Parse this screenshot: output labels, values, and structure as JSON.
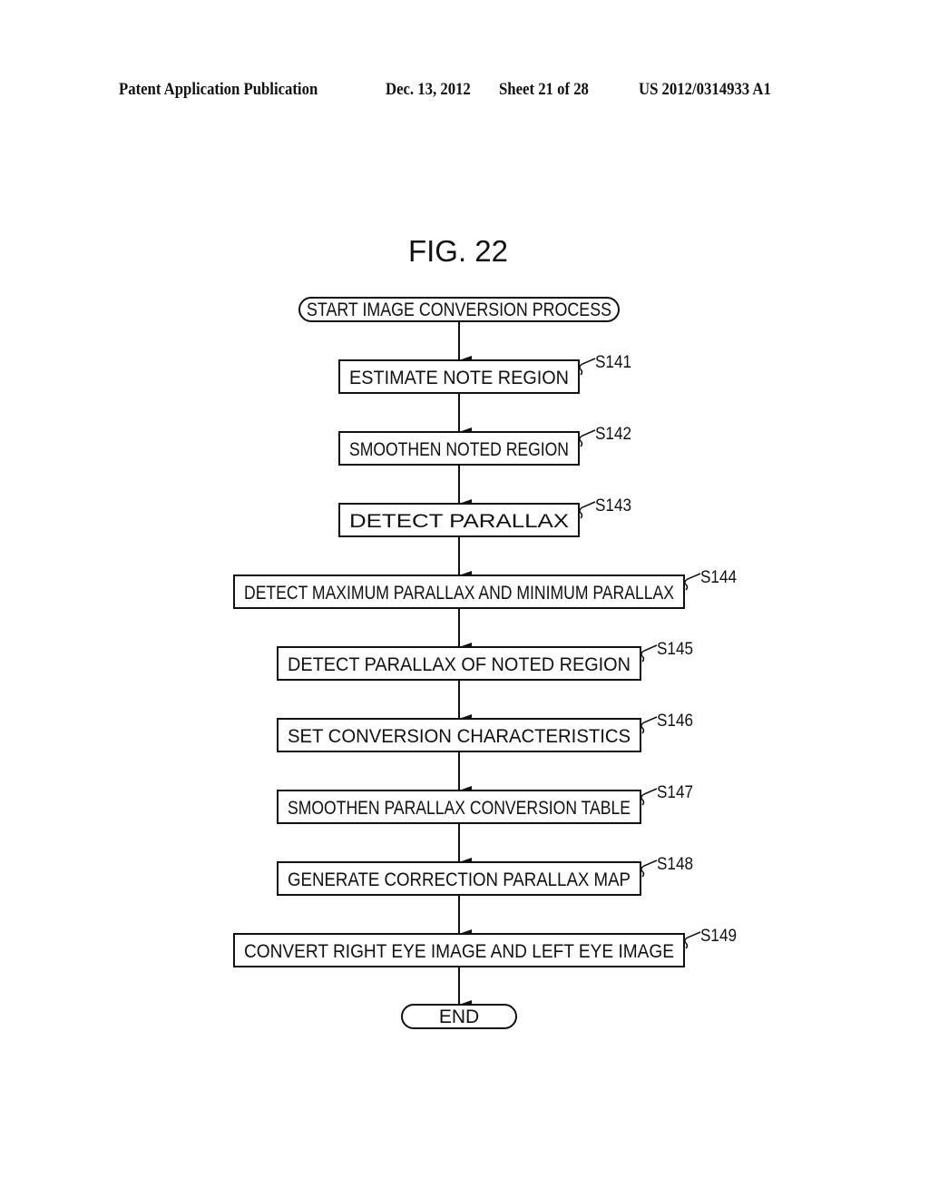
{
  "header": {
    "publication": "Patent Application Publication",
    "date": "Dec. 13, 2012",
    "sheet": "Sheet 21 of 28",
    "patent_number": "US 2012/0314933 A1"
  },
  "figure": {
    "title": "FIG. 22",
    "start": "START IMAGE CONVERSION PROCESS",
    "end": "END",
    "steps": [
      {
        "id": "S141",
        "label": "ESTIMATE NOTE REGION"
      },
      {
        "id": "S142",
        "label": "SMOOTHEN NOTED REGION"
      },
      {
        "id": "S143",
        "label": "DETECT PARALLAX"
      },
      {
        "id": "S144",
        "label": "DETECT MAXIMUM PARALLAX AND MINIMUM PARALLAX"
      },
      {
        "id": "S145",
        "label": "DETECT PARALLAX OF NOTED REGION"
      },
      {
        "id": "S146",
        "label": "SET CONVERSION CHARACTERISTICS"
      },
      {
        "id": "S147",
        "label": "SMOOTHEN PARALLAX CONVERSION TABLE"
      },
      {
        "id": "S148",
        "label": "GENERATE CORRECTION PARALLAX MAP"
      },
      {
        "id": "S149",
        "label": "CONVERT RIGHT EYE IMAGE AND LEFT EYE IMAGE"
      }
    ]
  }
}
